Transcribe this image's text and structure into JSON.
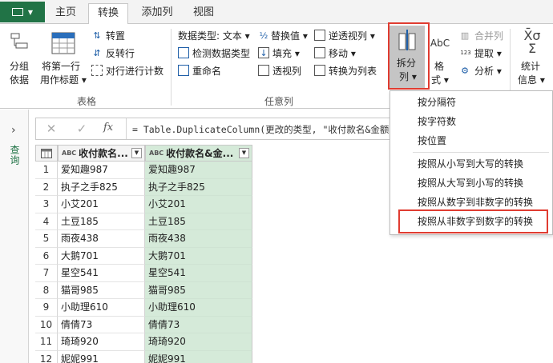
{
  "tabs": {
    "home": "主页",
    "transform": "转换",
    "add_column": "添加列",
    "view": "视图"
  },
  "ribbon": {
    "table_group": {
      "group_by": [
        "分组",
        "依据"
      ],
      "use_first_row": [
        "将第一行",
        "用作标题 ▾"
      ],
      "transpose": "转置",
      "reverse_rows": "反转行",
      "count_rows": "对行进行计数",
      "label": "表格"
    },
    "any_column_group": {
      "data_type": "数据类型: 文本 ▾",
      "detect_type": "检测数据类型",
      "rename": "重命名",
      "replace_values": "替换值 ▾",
      "fill": "填充 ▾",
      "pivot_column": "透视列",
      "unpivot_columns": "逆透视列 ▾",
      "move": "移动 ▾",
      "convert_to_list": "转换为列表",
      "label": "任意列"
    },
    "split_column": [
      "拆分",
      "列 ▾"
    ],
    "format": [
      "格",
      "式 ▾"
    ],
    "merge_columns": "合并列",
    "extract": "提取 ▾",
    "parse": "分析 ▾",
    "statistics": [
      "统计",
      "信息 ▾"
    ]
  },
  "formula": {
    "cancel": "✕",
    "confirm": "✓",
    "fx": "fx",
    "text": "= Table.DuplicateColumn(更改的类型, \"收付款名&金额\""
  },
  "queries_pane": {
    "label": "查询",
    "expand": "›"
  },
  "table": {
    "type_icon": "ABC",
    "columns": [
      "收付款名...",
      "收付款名&金..."
    ],
    "rows": [
      [
        "1",
        "爱知趣987",
        "爱知趣987"
      ],
      [
        "2",
        "执子之手825",
        "执子之手825"
      ],
      [
        "3",
        "小艾201",
        "小艾201"
      ],
      [
        "4",
        "土豆185",
        "土豆185"
      ],
      [
        "5",
        "雨夜438",
        "雨夜438"
      ],
      [
        "6",
        "大鹅701",
        "大鹅701"
      ],
      [
        "7",
        "星空541",
        "星空541"
      ],
      [
        "8",
        "猫哥985",
        "猫哥985"
      ],
      [
        "9",
        "小助理610",
        "小助理610"
      ],
      [
        "10",
        "倩倩73",
        "倩倩73"
      ],
      [
        "11",
        "琦琦920",
        "琦琦920"
      ],
      [
        "12",
        "妮妮991",
        "妮妮991"
      ]
    ]
  },
  "split_menu": {
    "items": [
      "按分隔符",
      "按字符数",
      "按位置",
      "按照从小写到大写的转换",
      "按照从大写到小写的转换",
      "按照从数字到非数字的转换",
      "按照从非数字到数字的转换"
    ]
  },
  "colors": {
    "accent": "#217346",
    "highlight": "#e03c31",
    "selected_column": "#d5ead9"
  }
}
